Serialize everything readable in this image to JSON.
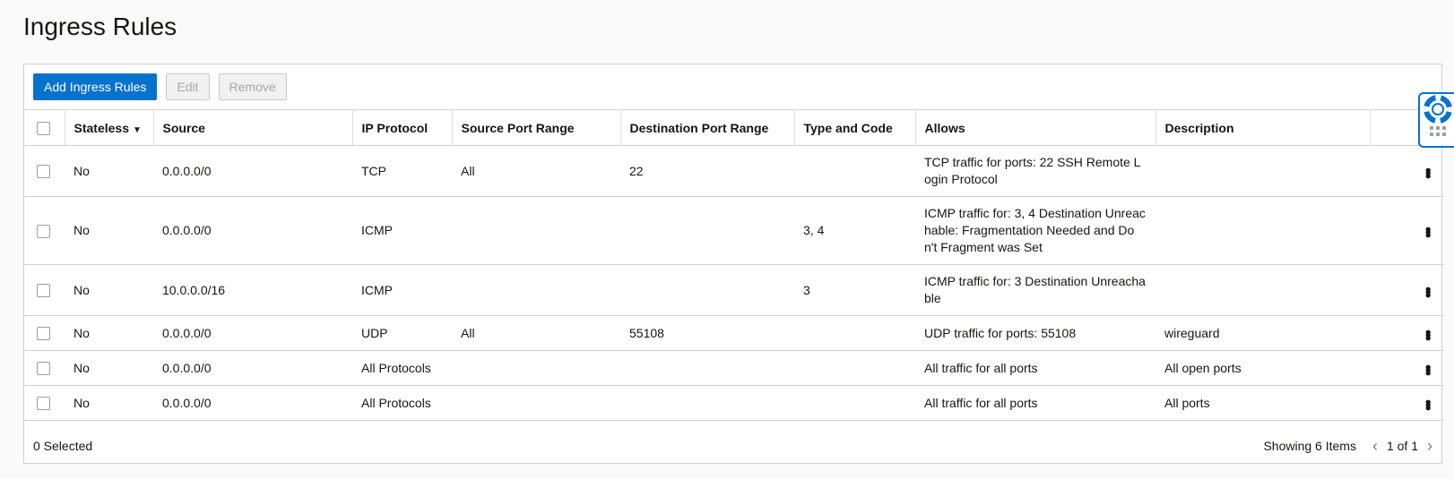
{
  "page": {
    "title": "Ingress Rules"
  },
  "toolbar": {
    "add_label": "Add Ingress Rules",
    "edit_label": "Edit",
    "remove_label": "Remove"
  },
  "columns": [
    "Stateless",
    "Source",
    "IP Protocol",
    "Source Port Range",
    "Destination Port Range",
    "Type and Code",
    "Allows",
    "Description"
  ],
  "rows": [
    {
      "stateless": "No",
      "source": "0.0.0.0/0",
      "protocol": "TCP",
      "src_port": "All",
      "dst_port": "22",
      "type_code": "",
      "allows": "TCP traffic for ports: 22 SSH Remote Login Protocol",
      "description": ""
    },
    {
      "stateless": "No",
      "source": "0.0.0.0/0",
      "protocol": "ICMP",
      "src_port": "",
      "dst_port": "",
      "type_code": "3, 4",
      "allows": "ICMP traffic for: 3, 4 Destination Unreachable: Fragmentation Needed and Don't Fragment was Set",
      "description": ""
    },
    {
      "stateless": "No",
      "source": "10.0.0.0/16",
      "protocol": "ICMP",
      "src_port": "",
      "dst_port": "",
      "type_code": "3",
      "allows": "ICMP traffic for: 3 Destination Unreachable",
      "description": ""
    },
    {
      "stateless": "No",
      "source": "0.0.0.0/0",
      "protocol": "UDP",
      "src_port": "All",
      "dst_port": "55108",
      "type_code": "",
      "allows": "UDP traffic for ports: 55108",
      "description": "wireguard"
    },
    {
      "stateless": "No",
      "source": "0.0.0.0/0",
      "protocol": "All Protocols",
      "src_port": "",
      "dst_port": "",
      "type_code": "",
      "allows": "All traffic for all ports",
      "description": "All open ports"
    },
    {
      "stateless": "No",
      "source": "0.0.0.0/0",
      "protocol": "All Protocols",
      "src_port": "",
      "dst_port": "",
      "type_code": "",
      "allows": "All traffic for all ports",
      "description": "All ports"
    }
  ],
  "footer": {
    "selected": "0 Selected",
    "showing": "Showing 6 Items",
    "page": "1 of 1"
  },
  "icons": {
    "sort": "caret-down-icon",
    "row_actions": "kebab-menu-icon",
    "help": "lifebuoy-icon"
  },
  "colors": {
    "primary": "#0572ce",
    "help_widget": "#0572ce"
  }
}
